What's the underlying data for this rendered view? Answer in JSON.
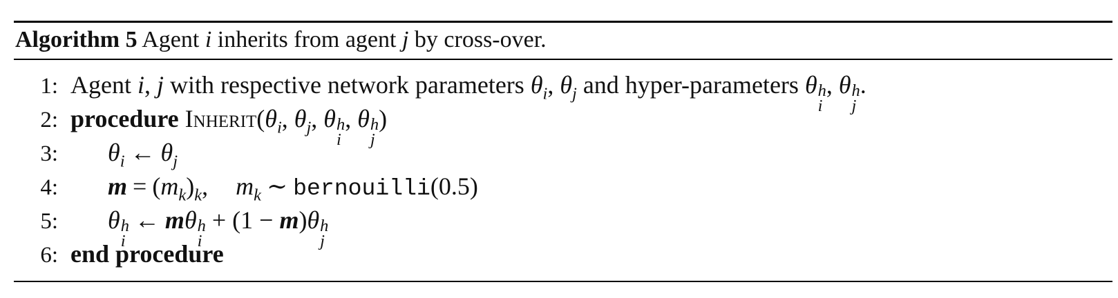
{
  "algorithm": {
    "label": "Algorithm 5",
    "caption": "Agent i inherits from agent j by cross-over.",
    "caption_parts": {
      "pre": "Agent ",
      "i": "i",
      "mid": " inherits from agent ",
      "j": "j",
      "post": " by cross-over."
    }
  },
  "lines": [
    {
      "number": "1:",
      "text_a": "Agent ",
      "i": "i",
      "comma": ", ",
      "j": "j",
      "text_b": " with respective network parameters ",
      "theta": "θ",
      "sub_i": "i",
      "sub_j": "j",
      "text_c": " and hyper-parameters ",
      "sup_h": "h",
      "end": "."
    },
    {
      "number": "2:",
      "keyword": "procedure",
      "name": "Inherit",
      "open": "(",
      "close": ")"
    },
    {
      "number": "3:",
      "arrow": "←"
    },
    {
      "number": "4:",
      "m": "m",
      "k": "k",
      "eq": "=",
      "sim": "∼",
      "func": "bernouilli",
      "arg": "(0.5)"
    },
    {
      "number": "5:",
      "expr_mid": " + (1 − ",
      "expr_close": ")"
    },
    {
      "number": "6:",
      "keyword": "end procedure"
    }
  ]
}
